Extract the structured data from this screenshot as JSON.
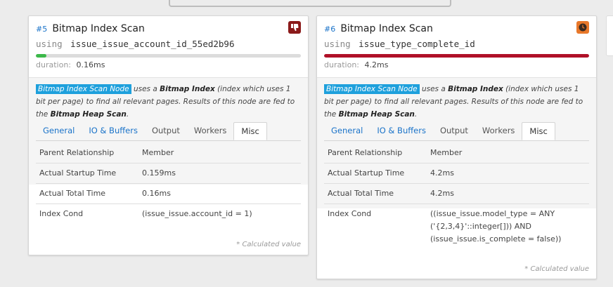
{
  "nodes": [
    {
      "id": "#5",
      "title": "Bitmap Index Scan",
      "badge": "thumbs-down-icon",
      "badge_color": "#8b1a1a",
      "using_kw": "using",
      "index_name": "issue_issue_account_id_55ed2b96",
      "bar_fraction": 0.04,
      "bar_color": "#3cb94a",
      "duration_label": "duration:",
      "duration_value": "0.16ms",
      "desc_tag": "Bitmap Index Scan Node",
      "desc_part1": " uses a ",
      "desc_bold1": "Bitmap Index",
      "desc_part2": " (index which uses 1 bit per page) to find all relevant pages. Results of this node are fed to the ",
      "desc_bold2": "Bitmap Heap Scan",
      "desc_part3": ".",
      "tabs": [
        "General",
        "IO & Buffers",
        "Output",
        "Workers",
        "Misc"
      ],
      "active_tab": "Misc",
      "rows": [
        {
          "k": "Parent Relationship",
          "v": "Member"
        },
        {
          "k": "Actual Startup Time",
          "v": "0.159ms"
        },
        {
          "k": "Actual Total Time",
          "v": "0.16ms"
        },
        {
          "k": "Index Cond",
          "v": "(issue_issue.account_id = 1)"
        }
      ],
      "calc_note": "* Calculated value"
    },
    {
      "id": "#6",
      "title": "Bitmap Index Scan",
      "badge": "clock-icon",
      "badge_color": "#e8782a",
      "using_kw": "using",
      "index_name": "issue_type_complete_id",
      "bar_fraction": 1.0,
      "bar_color": "#b01028",
      "duration_label": "duration:",
      "duration_value": "4.2ms",
      "desc_tag": "Bitmap Index Scan Node",
      "desc_part1": " uses a ",
      "desc_bold1": "Bitmap Index",
      "desc_part2": " (index which uses 1 bit per page) to find all relevant pages. Results of this node are fed to the ",
      "desc_bold2": "Bitmap Heap Scan",
      "desc_part3": ".",
      "tabs": [
        "General",
        "IO & Buffers",
        "Output",
        "Workers",
        "Misc"
      ],
      "active_tab": "Misc",
      "rows": [
        {
          "k": "Parent Relationship",
          "v": "Member"
        },
        {
          "k": "Actual Startup Time",
          "v": "4.2ms"
        },
        {
          "k": "Actual Total Time",
          "v": "4.2ms"
        },
        {
          "k": "Index Cond",
          "v": "((issue_issue.model_type = ANY ('{2,3,4}'::integer[])) AND (issue_issue.is_complete = false))"
        }
      ],
      "calc_note": "* Calculated value"
    }
  ]
}
